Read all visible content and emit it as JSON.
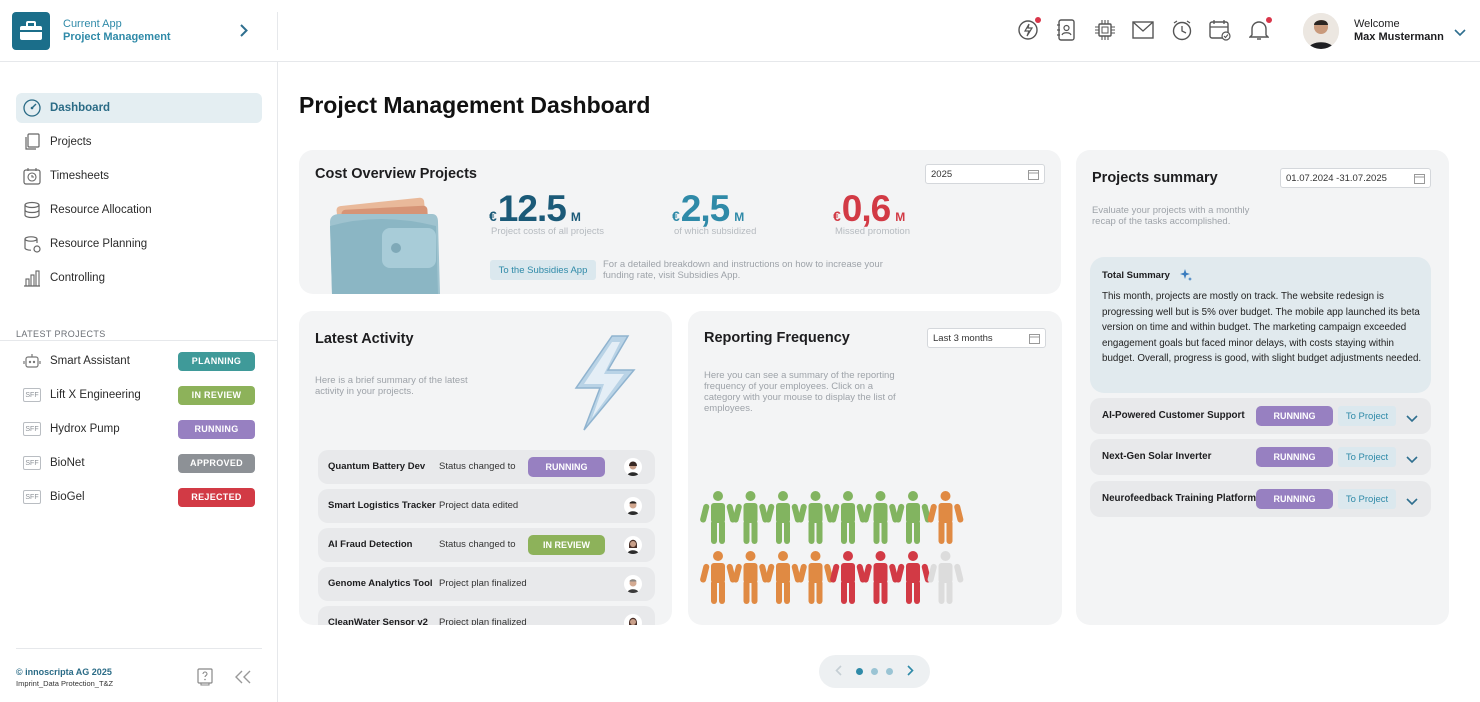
{
  "header": {
    "app_sub": "Current App",
    "app_name": "Project Management",
    "welcome": "Welcome",
    "user_name": "Max Mustermann",
    "icons": [
      "quick-action-icon",
      "contacts-icon",
      "chip-icon",
      "mail-icon",
      "time-icon",
      "calendar-check-icon",
      "bell-icon"
    ]
  },
  "sidebar": {
    "nav": [
      {
        "label": "Dashboard",
        "icon": "gauge-icon",
        "active": true
      },
      {
        "label": "Projects",
        "icon": "copy-icon"
      },
      {
        "label": "Timesheets",
        "icon": "stopwatch-icon"
      },
      {
        "label": "Resource Allocation",
        "icon": "database-icon"
      },
      {
        "label": "Resource Planning",
        "icon": "database-settings-icon"
      },
      {
        "label": "Controlling",
        "icon": "bar-chart-icon"
      }
    ],
    "latest_label": "LATEST PROJECTS",
    "projects": [
      {
        "name": "Smart Assistant",
        "status": "PLANNING",
        "color": "#3f9a99",
        "icon": "robot-icon"
      },
      {
        "name": "Lift X Engineering",
        "status": "IN REVIEW",
        "color": "#8db25a",
        "icon": "sff-icon"
      },
      {
        "name": "Hydrox Pump",
        "status": "RUNNING",
        "color": "#9780c1",
        "icon": "sff-icon"
      },
      {
        "name": "BioNet",
        "status": "APPROVED",
        "color": "#8d9196",
        "icon": "sff-icon"
      },
      {
        "name": "BioGel",
        "status": "REJECTED",
        "color": "#d23a45",
        "icon": "sff-icon"
      }
    ],
    "sff_label": "SFF",
    "copyright": "© innoscripta AG 2025",
    "links": "Imprint_Data Protection_T&Z"
  },
  "main": {
    "title": "Project Management Dashboard",
    "cost": {
      "title": "Cost Overview Projects",
      "year": "2025",
      "currency": "€",
      "metrics": [
        {
          "value": "12.5",
          "unit": "M",
          "label": "Project costs of all projects",
          "color": "#1b5a78"
        },
        {
          "value": "2,5",
          "unit": "M",
          "label": "of which subsidized",
          "color": "#2f8aa8"
        },
        {
          "value": "0,6",
          "unit": "M",
          "label": "Missed promotion",
          "color": "#d23a45"
        }
      ],
      "button": "To the Subsidies App",
      "hint": "For a detailed breakdown and instructions on how to increase your funding rate, visit Subsidies App."
    },
    "activity": {
      "title": "Latest Activity",
      "desc": "Here is a brief summary of the latest activity in your projects.",
      "rows": [
        {
          "name": "Quantum Battery Dev",
          "text": "Status changed to",
          "badge": "RUNNING",
          "badge_color": "#9780c1"
        },
        {
          "name": "Smart Logistics Tracker",
          "text": "Project data edited",
          "badge": ""
        },
        {
          "name": "AI Fraud Detection",
          "text": "Status changed to",
          "badge": "IN REVIEW",
          "badge_color": "#8db25a"
        },
        {
          "name": "Genome Analytics Tool",
          "text": "Project plan finalized",
          "badge": ""
        },
        {
          "name": "CleanWater Sensor v2",
          "text": "Project plan finalized",
          "badge": ""
        }
      ]
    },
    "reporting": {
      "title": "Reporting Frequency",
      "range": "Last 3 months",
      "desc": "Here you can see a summary of the reporting frequency of your employees. Click on a category with your mouse to display the list of employees.",
      "people_row1": [
        "green",
        "green",
        "green",
        "green",
        "green",
        "green",
        "green",
        "orange"
      ],
      "people_row2": [
        "orange",
        "orange",
        "orange",
        "orange",
        "red",
        "red",
        "red",
        "gray"
      ],
      "colors": {
        "green": "#82b460",
        "orange": "#e08a43",
        "red": "#d23a45",
        "gray": "#dcdcdc"
      }
    },
    "summary": {
      "title": "Projects summary",
      "range": "01.07.2024 -31.07.2025",
      "desc": "Evaluate your projects with a monthly recap of the tasks accomplished.",
      "total_title": "Total Summary",
      "total_text": "This month, projects are mostly on track. The website redesign is progressing well but is 5% over budget. The mobile app launched its beta version on time and within budget. The marketing campaign exceeded engagement goals but faced minor delays, with costs staying within budget. Overall, progress is good, with slight budget adjustments needed.",
      "projects": [
        {
          "name": "AI-Powered Customer Support",
          "status": "RUNNING",
          "link": "To Project"
        },
        {
          "name": "Next-Gen Solar Inverter",
          "status": "RUNNING",
          "link": "To Project"
        },
        {
          "name": "Neurofeedback Training Platform",
          "status": "RUNNING",
          "link": "To Project"
        }
      ]
    },
    "pager": {
      "pages": 3,
      "current": 1
    }
  }
}
